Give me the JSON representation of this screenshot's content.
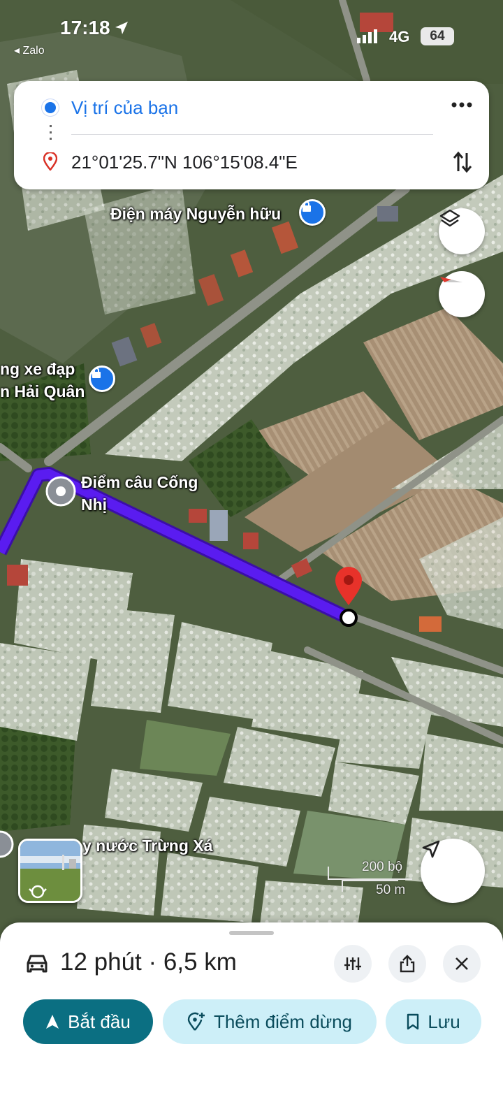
{
  "status_bar": {
    "time": "17:18",
    "back_app": "Zalo",
    "network": "4G",
    "battery": "64"
  },
  "route": {
    "origin": "Vị trí của bạn",
    "destination": "21°01'25.7\"N 106°15'08.4\"E",
    "more_icon": "more-vert-icon",
    "swap_icon": "swap-vertical-icon"
  },
  "map": {
    "labels": {
      "shop_1": "Điện máy Nguyễn hữu",
      "shop_2_line1": "ng xe đạp",
      "shop_2_line2": "n Hải Quân",
      "fishing_line1": "Điểm câu Cống",
      "fishing_line2": "Nhị",
      "water_plant": "y nước Trừng Xá"
    },
    "scale": {
      "imperial": "200 bộ",
      "metric": "50 m"
    },
    "route_color": "#5a1cf0",
    "destination_pin_color": "#e8322a"
  },
  "sheet": {
    "duration_distance": "12 phút · 6,5 km",
    "vehicle_icon": "car-icon",
    "start_label": "Bắt đầu",
    "add_stop_label": "Thêm điểm dừng",
    "save_label": "Lưu",
    "accent": "#0b6f82"
  }
}
